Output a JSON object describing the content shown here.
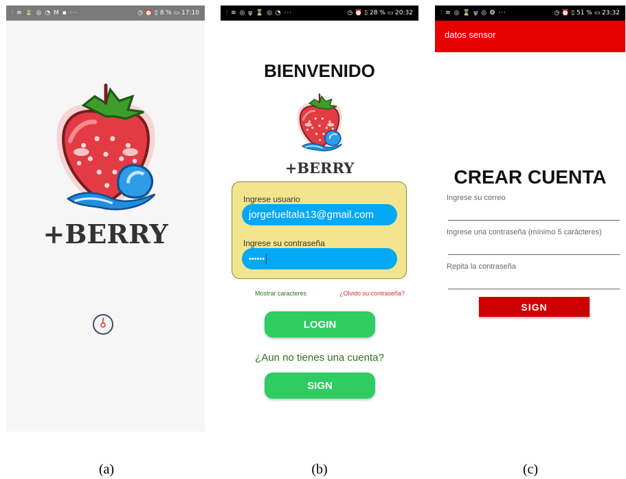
{
  "panel_a": {
    "status": {
      "icons": "⫶ ≋ ⌛ ◎ ◔ M ▪ ···",
      "right": "◷ ⏰ ▯ 8 % ▭ 17:10"
    },
    "brand": "+BERRY",
    "caption": "(a)"
  },
  "panel_b": {
    "status": {
      "icons": "⫶ ≋ ◎ ψ ⌛ ◎ ◔ ···",
      "right": "◷ ⏰ ▯ 28 % ▭ 20:32"
    },
    "title": "BIENVENIDO",
    "brand": "+BERRY",
    "user_label": "Ingrese usuario",
    "user_value": "jorgefueltala13@gmail.com",
    "pass_label": "Ingrese su contraseña",
    "pass_value": "••••••",
    "show_chars": "Mostrar caracteres",
    "forgot": "¿Olvido su contraseña?",
    "login_button": "LOGIN",
    "no_account": "¿Aun no tienes una cuenta?",
    "sign_button": "SIGN",
    "caption": "(b)"
  },
  "panel_c": {
    "status": {
      "icons": "⫶ ≋ ◎ ⌛ ψ ◎ ❂ ···",
      "right": "◷ ⏰ ▯ 51 % ▭ 23:32"
    },
    "appbar_title": "datos sensor",
    "title": "CREAR CUENTA",
    "email_label": "Ingrese su correo",
    "pass_label": "Ingrese una contraseña (mínimo 5 carácteres)",
    "pass2_label": "Repita la contraseña",
    "sign_button": "SIGN",
    "caption": "(c)"
  },
  "colors": {
    "accent_blue": "#03a9f4",
    "green": "#2ecc61",
    "red": "#e60000",
    "card": "#f2e58d"
  }
}
